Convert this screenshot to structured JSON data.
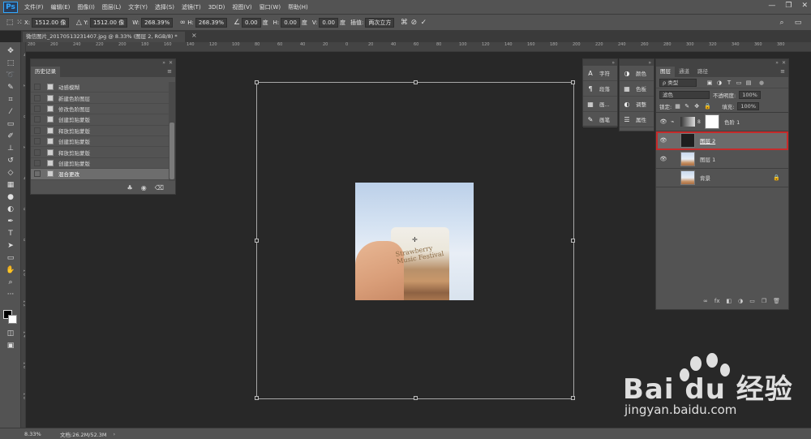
{
  "menubar": {
    "logo": "Ps",
    "items": [
      "文件(F)",
      "编辑(E)",
      "图像(I)",
      "图层(L)",
      "文字(Y)",
      "选择(S)",
      "滤镜(T)",
      "3D(D)",
      "视图(V)",
      "窗口(W)",
      "帮助(H)"
    ],
    "controls": [
      "—",
      "❐",
      "✕"
    ]
  },
  "options": {
    "x_label": "X:",
    "x_value": "1512.00 像",
    "y_label": "Y:",
    "y_value": "1512.00 像",
    "w_label": "W:",
    "w_value": "268.39%",
    "h_label": "H:",
    "h_value": "268.39%",
    "angle_value": "0.00",
    "angle_unit": "度",
    "hskew_label": "H:",
    "hskew_value": "0.00",
    "hskew_unit": "度",
    "vskew_label": "V:",
    "vskew_value": "0.00",
    "vskew_unit": "度",
    "interp_label": "插值:",
    "interp_value": "两次立方"
  },
  "doc_tab": {
    "title": "微信图片_20170513231407.jpg @ 8.33% (图层 2, RGB/8) *",
    "close": "×"
  },
  "ruler": {
    "top_ticks": [
      "280",
      "260",
      "240",
      "220",
      "200",
      "180",
      "160",
      "140",
      "120",
      "100",
      "80",
      "60",
      "40",
      "20",
      "0",
      "20",
      "40",
      "60",
      "80",
      "100",
      "120",
      "140",
      "160",
      "180",
      "200",
      "220",
      "240",
      "260",
      "280",
      "300",
      "320",
      "340",
      "360",
      "380"
    ],
    "left_ticks": [
      "4",
      "2",
      "0",
      "2",
      "4",
      "6",
      "8",
      "1 0",
      "1 2",
      "1 4",
      "1 6",
      "1 8"
    ]
  },
  "canvas": {
    "cup_text": "Strawberry Music Festival"
  },
  "status": {
    "zoom": "8.33%",
    "doc": "文档:26.2M/52.3M",
    "arrow": "›"
  },
  "history": {
    "tab": "历史记录",
    "items": [
      "动感模糊",
      "新建色阶图层",
      "修改色阶图层",
      "创建剪贴蒙版",
      "释放剪贴蒙版",
      "创建剪贴蒙版",
      "释放剪贴蒙版",
      "创建剪贴蒙版",
      "混合更改"
    ],
    "selected_index": 8
  },
  "icon_col_1": {
    "items": [
      {
        "glyph": "A",
        "label": "字符"
      },
      {
        "glyph": "¶",
        "label": "段落"
      },
      {
        "glyph": "▦",
        "label": "画..."
      },
      {
        "glyph": "✎",
        "label": "画笔"
      }
    ]
  },
  "icon_col_2": {
    "items": [
      {
        "glyph": "◑",
        "label": "颜色"
      },
      {
        "glyph": "▦",
        "label": "色板"
      },
      {
        "glyph": "◐",
        "label": "调整"
      },
      {
        "glyph": "☰",
        "label": "属性"
      }
    ]
  },
  "layers": {
    "tabs": [
      "图层",
      "通道",
      "路径"
    ],
    "filter_kind": "ρ 类型",
    "blend_mode": "滤色",
    "opacity_label": "不透明度:",
    "opacity_value": "100%",
    "lock_label": "锁定:",
    "fill_label": "填充:",
    "fill_value": "100%",
    "rows": [
      {
        "name": "色阶 1",
        "visible": true,
        "thumb": "adjust"
      },
      {
        "name": "图层 2",
        "visible": true,
        "thumb": "dark",
        "selected": true
      },
      {
        "name": "图层 1",
        "visible": true,
        "thumb": "photo"
      },
      {
        "name": "背景",
        "visible": false,
        "thumb": "photo",
        "locked": true
      }
    ],
    "footer_icons": [
      "∞",
      "fx",
      "◧",
      "◑",
      "▭",
      "❐",
      "🗑"
    ]
  },
  "watermark": {
    "brand": "Bai du 经验",
    "url": "jingyan.baidu.com"
  },
  "colors": {
    "accent": "#31a8ff",
    "selected_outline": "#c62b2b"
  }
}
